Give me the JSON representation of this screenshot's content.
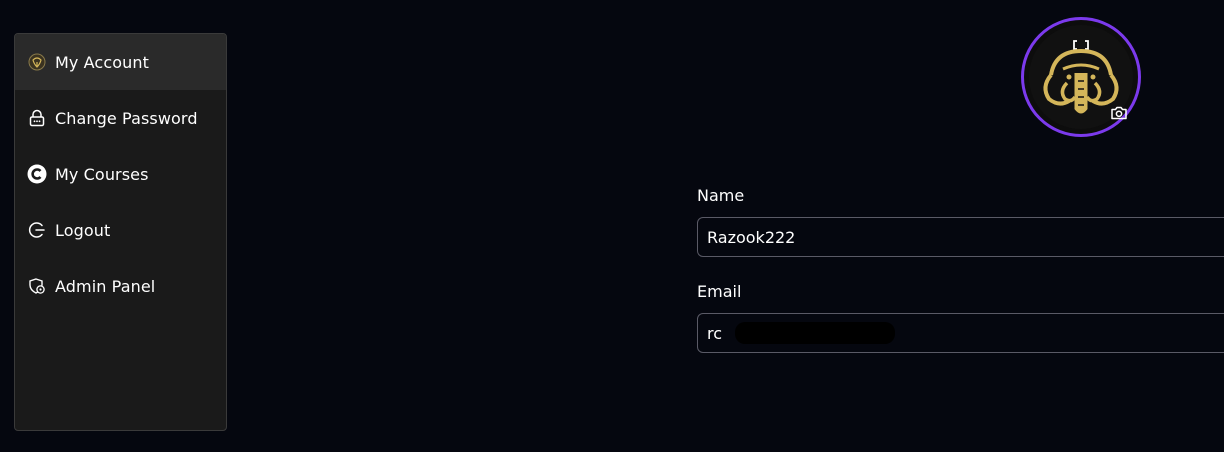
{
  "sidebar": {
    "items": [
      {
        "label": "My Account",
        "icon": "mascot-icon",
        "active": true
      },
      {
        "label": "Change Password",
        "icon": "lock-icon",
        "active": false
      },
      {
        "label": "My Courses",
        "icon": "courses-logo-icon",
        "active": false
      },
      {
        "label": "Logout",
        "icon": "logout-icon",
        "active": false
      },
      {
        "label": "Admin Panel",
        "icon": "admin-shield-icon",
        "active": false
      }
    ]
  },
  "profile": {
    "avatar_icon": "mammoth-avatar",
    "camera_icon": "camera-icon",
    "ring_color": "#7c3aed"
  },
  "form": {
    "name_label": "Name",
    "name_value": "Razook222",
    "email_label": "Email",
    "email_value_visible": "rc"
  },
  "colors": {
    "background": "#05070f",
    "sidebar_bg": "#1a1a1a",
    "active_item_bg": "#2a2a2a",
    "gold": "#d4b65a"
  }
}
